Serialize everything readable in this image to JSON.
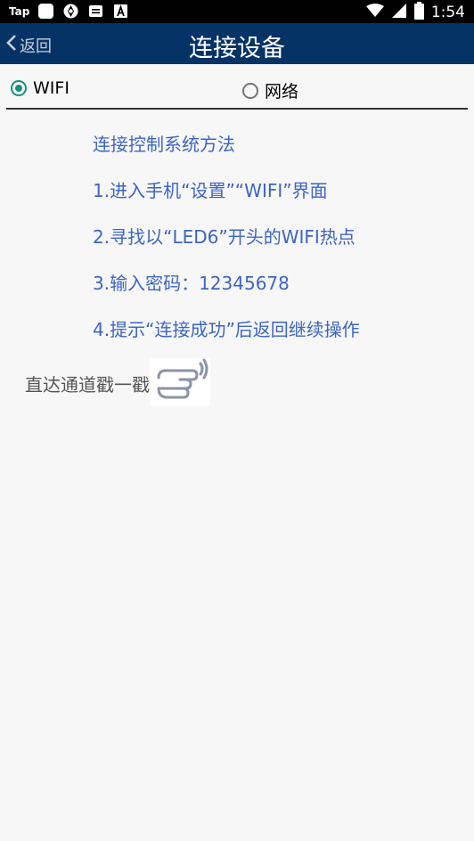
{
  "status_bar": {
    "app_label": "Tap",
    "time": "1:54",
    "icons": [
      "app-square-icon",
      "shutter-icon",
      "message-icon",
      "font-a-icon",
      "wifi-icon",
      "signal-icon",
      "battery-icon"
    ]
  },
  "nav": {
    "back_label": "返回",
    "title": "连接设备",
    "bg_color": "#053366"
  },
  "mode": {
    "options": [
      {
        "label": "WIFI",
        "checked": true
      },
      {
        "label": "网络",
        "checked": false
      }
    ],
    "accent_color": "#15907f"
  },
  "instructions": [
    "连接控制系统方法",
    "1.进入手机“设置”“WIFI”界面",
    "2.寻找以“LED6”开头的WIFI热点",
    "3.输入密码：12345678",
    "4.提示“连接成功”后返回继续操作"
  ],
  "instruction_color": "#3d64c6",
  "shortcut": {
    "label": "直达通道戳一戳",
    "icon": "pointing-hand-icon"
  }
}
